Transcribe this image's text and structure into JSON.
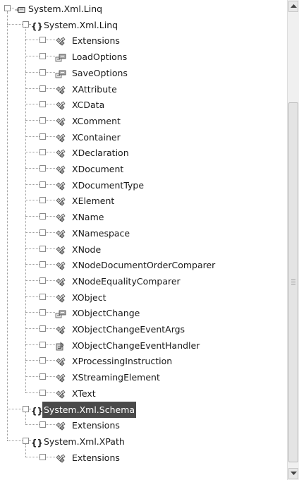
{
  "tree": {
    "root": {
      "label": "System.Xml.Linq",
      "icon": "assembly-icon",
      "expanded": true
    },
    "namespaces": [
      {
        "label": "System.Xml.Linq",
        "icon": "namespace-braces-icon",
        "expanded": true,
        "selected": false,
        "types": [
          {
            "label": "Extensions",
            "icon": "class-icon"
          },
          {
            "label": "LoadOptions",
            "icon": "enum-icon"
          },
          {
            "label": "SaveOptions",
            "icon": "enum-icon"
          },
          {
            "label": "XAttribute",
            "icon": "class-icon"
          },
          {
            "label": "XCData",
            "icon": "class-icon"
          },
          {
            "label": "XComment",
            "icon": "class-icon"
          },
          {
            "label": "XContainer",
            "icon": "class-icon"
          },
          {
            "label": "XDeclaration",
            "icon": "class-icon"
          },
          {
            "label": "XDocument",
            "icon": "class-icon"
          },
          {
            "label": "XDocumentType",
            "icon": "class-icon"
          },
          {
            "label": "XElement",
            "icon": "class-icon"
          },
          {
            "label": "XName",
            "icon": "class-icon"
          },
          {
            "label": "XNamespace",
            "icon": "class-icon"
          },
          {
            "label": "XNode",
            "icon": "class-icon"
          },
          {
            "label": "XNodeDocumentOrderComparer",
            "icon": "class-icon"
          },
          {
            "label": "XNodeEqualityComparer",
            "icon": "class-icon"
          },
          {
            "label": "XObject",
            "icon": "class-icon"
          },
          {
            "label": "XObjectChange",
            "icon": "enum-icon"
          },
          {
            "label": "XObjectChangeEventArgs",
            "icon": "class-icon"
          },
          {
            "label": "XObjectChangeEventHandler",
            "icon": "delegate-icon"
          },
          {
            "label": "XProcessingInstruction",
            "icon": "class-icon"
          },
          {
            "label": "XStreamingElement",
            "icon": "class-icon"
          },
          {
            "label": "XText",
            "icon": "class-icon"
          }
        ]
      },
      {
        "label": "System.Xml.Schema",
        "icon": "namespace-braces-icon",
        "expanded": true,
        "selected": true,
        "types": [
          {
            "label": "Extensions",
            "icon": "class-icon"
          }
        ]
      },
      {
        "label": "System.Xml.XPath",
        "icon": "namespace-braces-icon",
        "expanded": true,
        "selected": false,
        "types": [
          {
            "label": "Extensions",
            "icon": "class-icon"
          }
        ]
      }
    ]
  },
  "expander_glyphs": {
    "expanded": "−",
    "collapsed": "+"
  },
  "colors": {
    "selection_bg": "#4a4a4a",
    "selection_fg": "#ffffff",
    "tree_lines": "#9a9a9a"
  }
}
